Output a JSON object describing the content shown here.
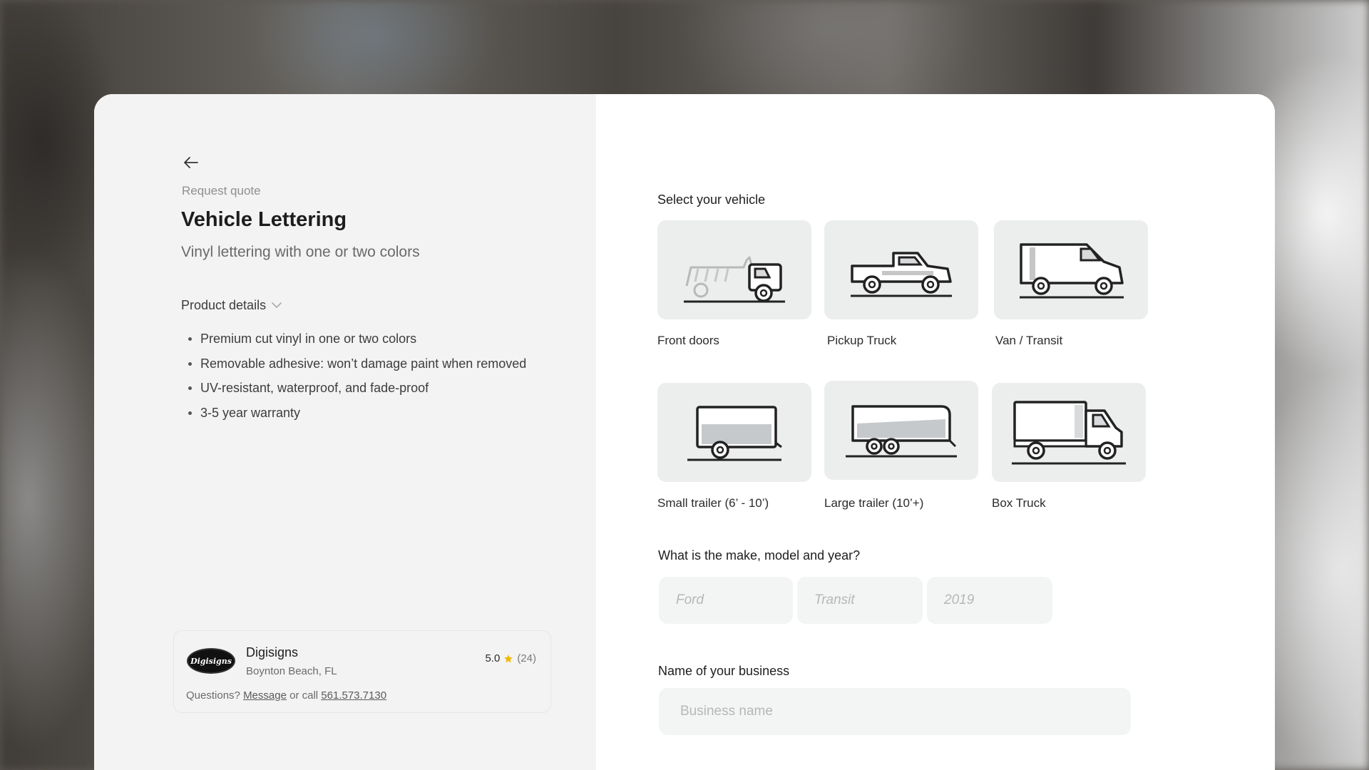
{
  "left": {
    "eyebrow": "Request quote",
    "title": "Vehicle Lettering",
    "subtitle": "Vinyl lettering with one or two colors",
    "details_toggle": "Product details",
    "bullets": [
      "Premium cut vinyl in one or two colors",
      "Removable adhesive: won’t damage paint when removed",
      "UV-resistant, waterproof, and fade-proof",
      "3-5 year warranty"
    ]
  },
  "vendor": {
    "logo_text": "Digisigns",
    "name": "Digisigns",
    "location": "Boynton Beach, FL",
    "rating": "5.0",
    "review_count": "(24)",
    "questions_prefix": "Questions?",
    "message_link": "Message",
    "or_call": "or call",
    "phone": "561.573.7130"
  },
  "vehicle_section": {
    "label": "Select your vehicle",
    "options": [
      {
        "label": "Front doors",
        "icon": "dump-truck-icon"
      },
      {
        "label": "Pickup Truck",
        "icon": "pickup-truck-icon"
      },
      {
        "label": "Van / Transit",
        "icon": "van-icon"
      },
      {
        "label": "Small trailer (6’ - 10’)",
        "icon": "small-trailer-icon"
      },
      {
        "label": "Large trailer (10’+)",
        "icon": "large-trailer-icon"
      },
      {
        "label": "Box Truck",
        "icon": "box-truck-icon"
      }
    ]
  },
  "make_section": {
    "label": "What is the make, model and year?",
    "make_placeholder": "Ford",
    "model_placeholder": "Transit",
    "year_placeholder": "2019"
  },
  "business_section": {
    "label": "Name of your business",
    "placeholder": "Business name"
  },
  "colors": {
    "accent_star": "#f2b705",
    "tile_bg": "#eceeee",
    "panel_bg": "#f3f3f3"
  }
}
